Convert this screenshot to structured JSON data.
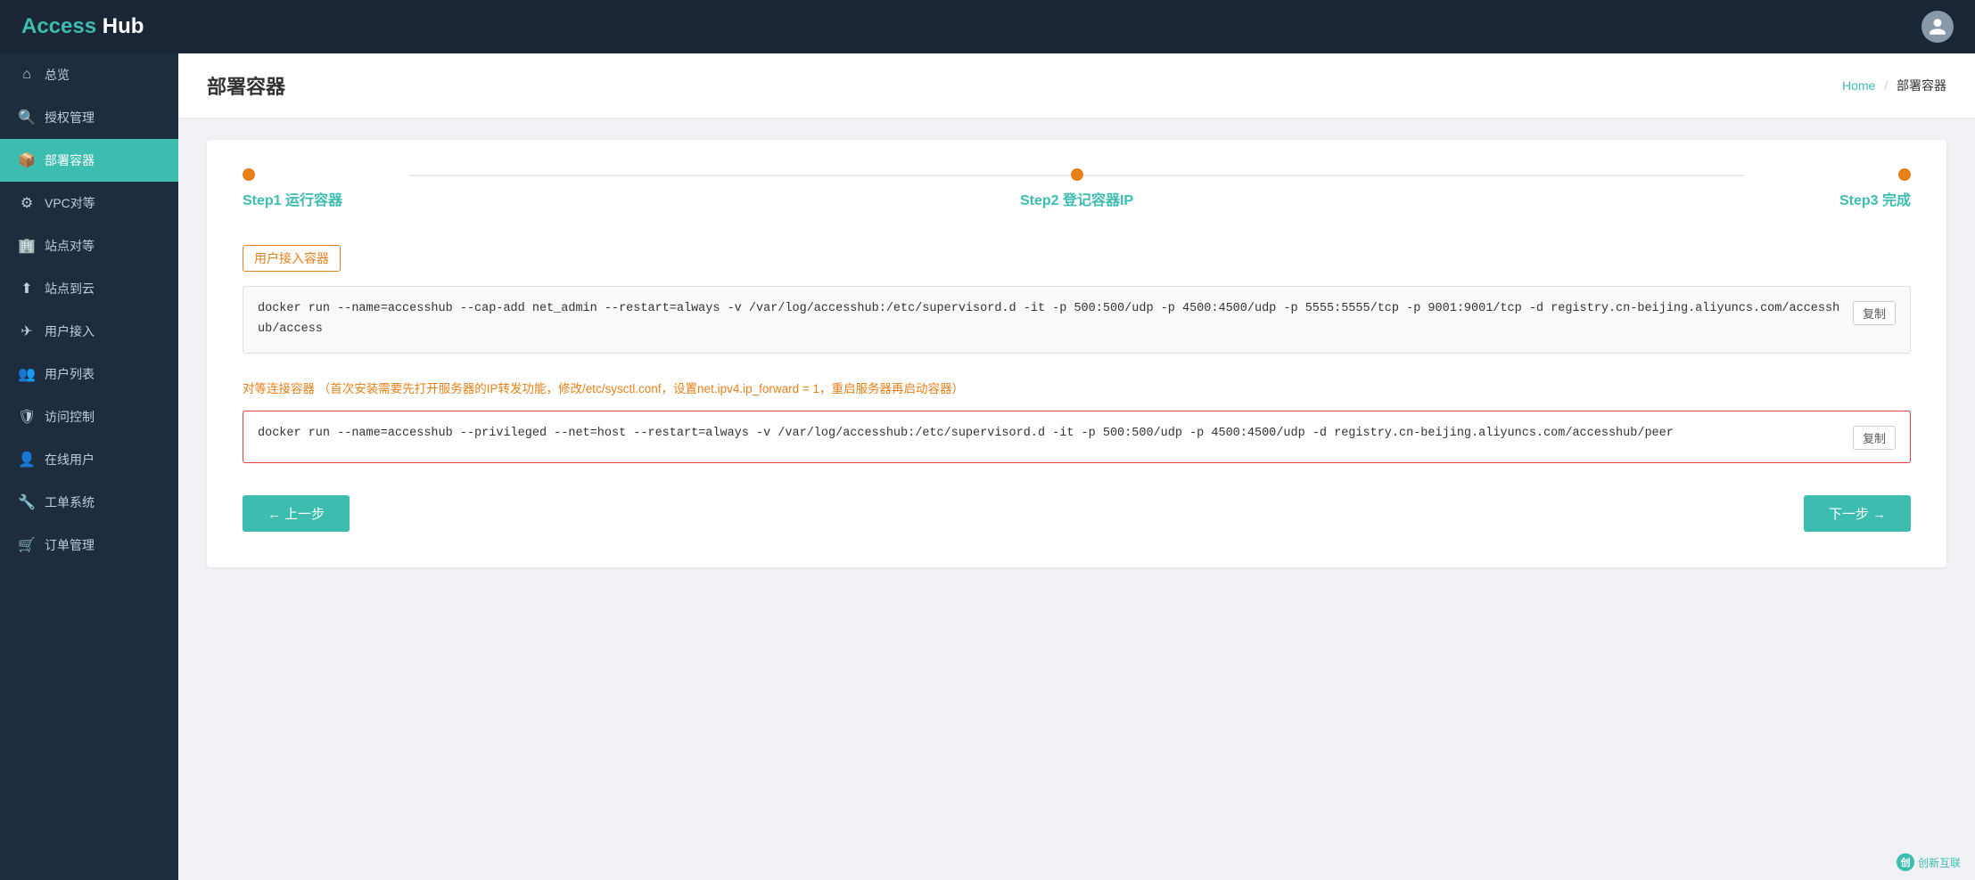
{
  "app": {
    "title_access": "Access",
    "title_hub": " Hub"
  },
  "header": {
    "avatar_label": "user avatar"
  },
  "sidebar": {
    "items": [
      {
        "id": "overview",
        "label": "总览",
        "icon": "⌂",
        "active": false
      },
      {
        "id": "auth",
        "label": "授权管理",
        "icon": "🔍",
        "active": false
      },
      {
        "id": "deploy",
        "label": "部署容器",
        "icon": "📦",
        "active": true
      },
      {
        "id": "vpc",
        "label": "VPC对等",
        "icon": "⚙",
        "active": false
      },
      {
        "id": "site-peer",
        "label": "站点对等",
        "icon": "🏢",
        "active": false
      },
      {
        "id": "site-cloud",
        "label": "站点到云",
        "icon": "⬆",
        "active": false
      },
      {
        "id": "user-access",
        "label": "用户接入",
        "icon": "✈",
        "active": false
      },
      {
        "id": "user-list",
        "label": "用户列表",
        "icon": "👥",
        "active": false
      },
      {
        "id": "access-ctrl",
        "label": "访问控制",
        "icon": "🛡",
        "active": false
      },
      {
        "id": "online-user",
        "label": "在线用户",
        "icon": "👤",
        "active": false
      },
      {
        "id": "ticket",
        "label": "工单系统",
        "icon": "🔧",
        "active": false
      },
      {
        "id": "order",
        "label": "订单管理",
        "icon": "🛒",
        "active": false
      }
    ]
  },
  "page": {
    "title": "部署容器",
    "breadcrumb_home": "Home",
    "breadcrumb_sep": "/",
    "breadcrumb_current": "部署容器"
  },
  "steps": [
    {
      "id": "step1",
      "label": "Step1 运行容器"
    },
    {
      "id": "step2",
      "label": "Step2 登记容器IP"
    },
    {
      "id": "step3",
      "label": "Step3 完成"
    }
  ],
  "sections": {
    "user_container_label": "用户接入容器",
    "user_container_cmd": "docker run --name=accesshub --cap-add net_admin --restart=always -v /var/log/accesshub:/etc/supervisord.d -it -p 500:500/udp -p 4500:4500/udp -p 5555:5555/tcp -p 9001:9001/tcp -d registry.cn-beijing.aliyuncs.com/accesshub/access",
    "copy_btn1": "复制",
    "peer_container_label": "对等连接容器",
    "peer_container_warning": "（首次安装需要先打开服务器的IP转发功能，修改/etc/sysctl.conf，设置net.ipv4.ip_forward = 1，重启服务器再启动容器）",
    "peer_container_cmd": "docker run --name=accesshub --privileged --net=host --restart=always -v /var/log/accesshub:/etc/supervisord.d -it -p 500:500/udp -p 4500:4500/udp -d registry.cn-beijing.aliyuncs.com/accesshub/peer",
    "copy_btn2": "复制"
  },
  "footer": {
    "back_btn": "← 上一步",
    "next_btn": "下一步 →"
  },
  "watermark": {
    "icon": "创",
    "text": "创新互联"
  }
}
